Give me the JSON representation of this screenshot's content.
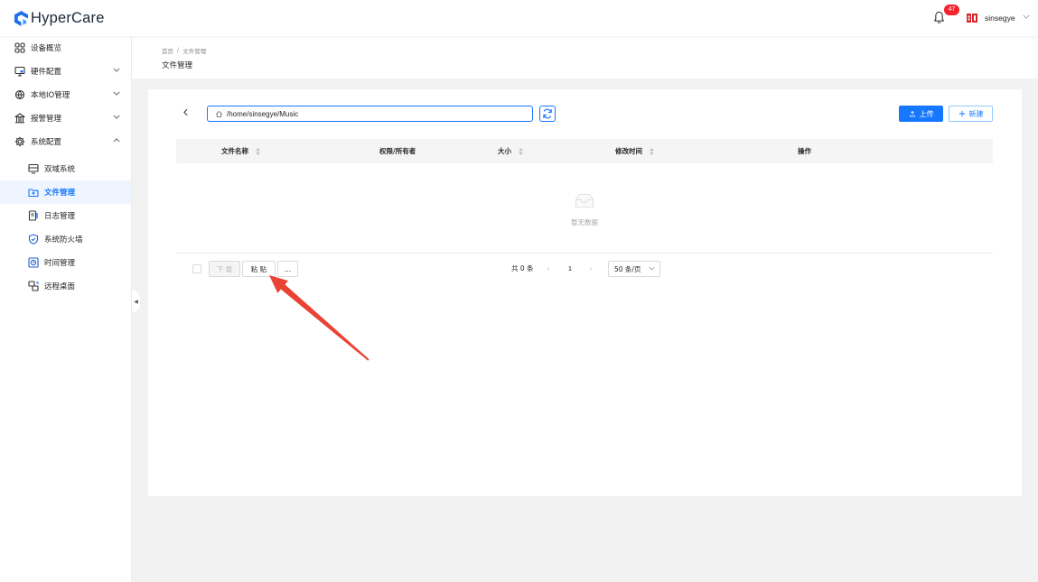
{
  "app": {
    "logo_text": "HyperCare"
  },
  "header": {
    "notifications": {
      "icon": "bell-icon",
      "count": "47"
    },
    "user": {
      "avatar_icon": "brand-logo-icon",
      "name": "sinsegye",
      "dropdown_icon": "chevron-down-icon"
    }
  },
  "sidebar": {
    "menu": [
      {
        "label": "设备概览",
        "icon": "grid-icon"
      },
      {
        "label": "硬件配置",
        "icon": "monitor-icon",
        "expanded": false
      },
      {
        "label": "本地IO管理",
        "icon": "network-icon",
        "expanded": false
      },
      {
        "label": "报警管理",
        "icon": "alarm-icon",
        "expanded": false
      },
      {
        "label": "系统配置",
        "icon": "gear-icon",
        "expanded": true
      }
    ],
    "submenu": [
      {
        "label": "双域系统",
        "icon": "dual-domain-icon"
      },
      {
        "label": "文件管理",
        "icon": "folder-icon",
        "active": true
      },
      {
        "label": "日志管理",
        "icon": "log-icon"
      },
      {
        "label": "系统防火墙",
        "icon": "shield-icon"
      },
      {
        "label": "时间管理",
        "icon": "clock-icon"
      },
      {
        "label": "远程桌面",
        "icon": "remote-desktop-icon"
      }
    ]
  },
  "breadcrumb": {
    "home": "首页",
    "separator": "/",
    "current": "文件管理"
  },
  "page": {
    "title": "文件管理"
  },
  "toolbar": {
    "path": "/home/sinsegye/Music",
    "upload_label": "上传",
    "new_label": "新建"
  },
  "table": {
    "columns": [
      {
        "label": "文件名称",
        "sortable": true
      },
      {
        "label": "权限/所有者",
        "sortable": false
      },
      {
        "label": "大小",
        "sortable": true
      },
      {
        "label": "修改时间",
        "sortable": true
      },
      {
        "label": "操作",
        "sortable": false
      }
    ],
    "rows": [],
    "empty_text": "暂无数据"
  },
  "footer": {
    "select_all_checked": false,
    "download_label": "下 载",
    "download_disabled": true,
    "paste_label": "粘 贴",
    "more_label": "..."
  },
  "pagination": {
    "total": "共 0 条",
    "current_page": "1",
    "page_size": "50 条/页"
  },
  "colors": {
    "primary": "#1677ff",
    "badge": "#f5222d",
    "annotation": "#ea4335"
  }
}
